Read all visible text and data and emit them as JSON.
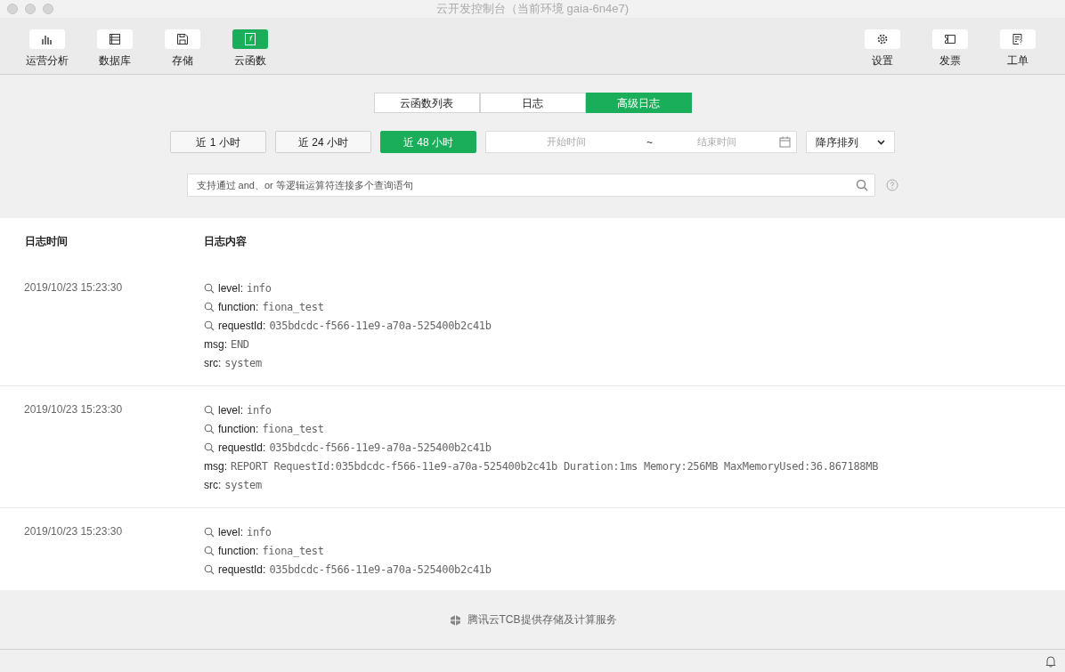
{
  "window": {
    "title": "云开发控制台（当前环境 gaia-6n4e7)"
  },
  "toolbar_left": [
    {
      "label": "运营分析",
      "selected": false
    },
    {
      "label": "数据库",
      "selected": false
    },
    {
      "label": "存储",
      "selected": false
    },
    {
      "label": "云函数",
      "selected": true
    }
  ],
  "toolbar_right": [
    {
      "label": "设置"
    },
    {
      "label": "发票"
    },
    {
      "label": "工单"
    }
  ],
  "tabs": [
    {
      "label": "云函数列表",
      "selected": false
    },
    {
      "label": "日志",
      "selected": false
    },
    {
      "label": "高级日志",
      "selected": true
    }
  ],
  "time_ranges": [
    {
      "label": "近 1 小时",
      "selected": false
    },
    {
      "label": "近 24 小时",
      "selected": false
    },
    {
      "label": "近 48 小时",
      "selected": true
    }
  ],
  "date_range": {
    "start_placeholder": "开始时间",
    "separator": "~",
    "end_placeholder": "结束时间"
  },
  "sort": {
    "value": "降序排列"
  },
  "search": {
    "placeholder": "支持通过 and、or 等逻辑运算符连接多个查询语句"
  },
  "table": {
    "columns": [
      "日志时间",
      "日志内容"
    ],
    "rows": [
      {
        "time": "2019/10/23 15:23:30",
        "fields": [
          {
            "key": "level:",
            "value": "info",
            "searchable": true
          },
          {
            "key": "function:",
            "value": "fiona_test",
            "searchable": true
          },
          {
            "key": "requestId:",
            "value": "035bdcdc-f566-11e9-a70a-525400b2c41b",
            "searchable": true
          },
          {
            "key": "msg:",
            "value": "END",
            "searchable": false
          },
          {
            "key": "src:",
            "value": "system",
            "searchable": false
          }
        ]
      },
      {
        "time": "2019/10/23 15:23:30",
        "fields": [
          {
            "key": "level:",
            "value": "info",
            "searchable": true
          },
          {
            "key": "function:",
            "value": "fiona_test",
            "searchable": true
          },
          {
            "key": "requestId:",
            "value": "035bdcdc-f566-11e9-a70a-525400b2c41b",
            "searchable": true
          },
          {
            "key": "msg:",
            "value": "REPORT RequestId:035bdcdc-f566-11e9-a70a-525400b2c41b Duration:1ms Memory:256MB MaxMemoryUsed:36.867188MB",
            "searchable": false
          },
          {
            "key": "src:",
            "value": "system",
            "searchable": false
          }
        ]
      },
      {
        "time": "2019/10/23 15:23:30",
        "fields": [
          {
            "key": "level:",
            "value": "info",
            "searchable": true
          },
          {
            "key": "function:",
            "value": "fiona_test",
            "searchable": true
          },
          {
            "key": "requestId:",
            "value": "035bdcdc-f566-11e9-a70a-525400b2c41b",
            "searchable": true
          }
        ]
      }
    ]
  },
  "footer": {
    "text": "腾讯云TCB提供存储及计算服务"
  }
}
